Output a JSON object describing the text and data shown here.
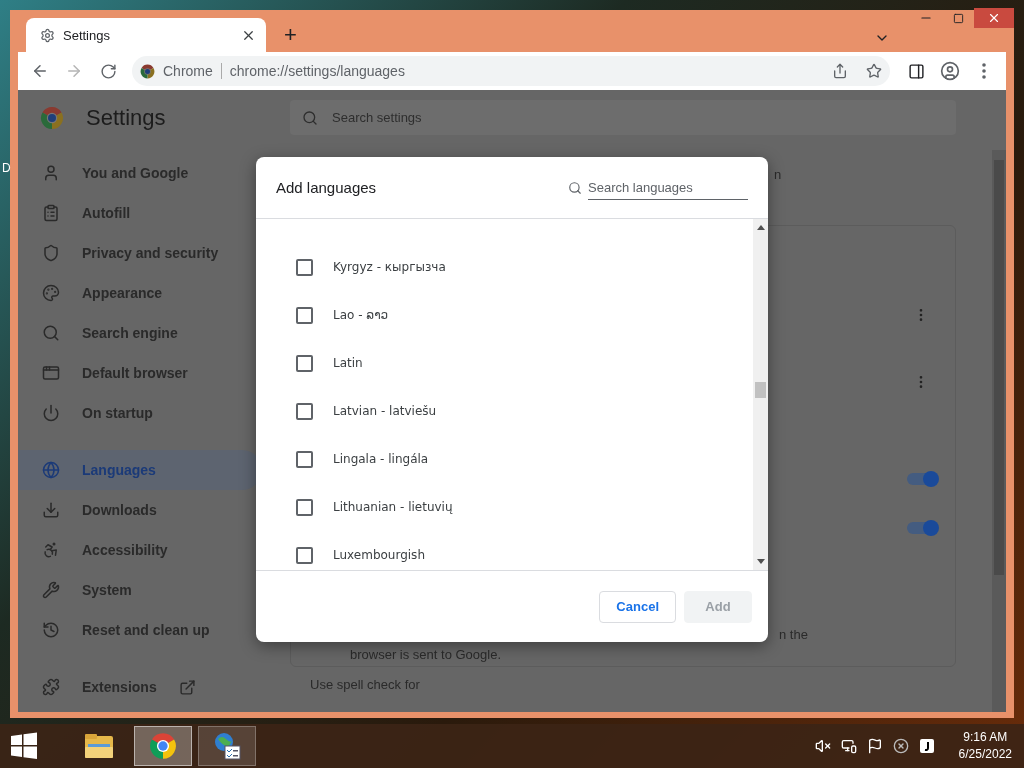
{
  "desktop": {
    "edge_text": "D"
  },
  "window": {
    "tabs": [
      {
        "title": "Settings",
        "selected": true
      }
    ],
    "new_tab": "+"
  },
  "toolbar": {
    "back_enabled": true,
    "forward_enabled": false,
    "chip": "Chrome",
    "url": "chrome://settings/languages"
  },
  "settings": {
    "title": "Settings",
    "search_placeholder": "Search settings",
    "sidebar": [
      {
        "label": "You and Google",
        "selected": false
      },
      {
        "label": "Autofill",
        "selected": false
      },
      {
        "label": "Privacy and security",
        "selected": false
      },
      {
        "label": "Appearance",
        "selected": false
      },
      {
        "label": "Search engine",
        "selected": false
      },
      {
        "label": "Default browser",
        "selected": false
      },
      {
        "label": "On startup",
        "selected": false
      },
      {
        "label": "Languages",
        "selected": true
      },
      {
        "label": "Downloads",
        "selected": false
      },
      {
        "label": "Accessibility",
        "selected": false
      },
      {
        "label": "System",
        "selected": false
      },
      {
        "label": "Reset and clean up",
        "selected": false
      }
    ],
    "extensions": "Extensions",
    "content": {
      "fragment_top": "n",
      "toggles": [
        {
          "on": true
        },
        {
          "on": true
        }
      ],
      "fragment_line": "n the",
      "line_2": "browser is sent to Google.",
      "section": "Use spell check for"
    }
  },
  "dialog": {
    "title": "Add languages",
    "search_placeholder": "Search languages",
    "languages": [
      {
        "label": "Kyrgyz - кыргызча",
        "checked": false
      },
      {
        "label": "Lao - ລາວ",
        "checked": false
      },
      {
        "label": "Latin",
        "checked": false
      },
      {
        "label": "Latvian - latviešu",
        "checked": false
      },
      {
        "label": "Lingala - lingála",
        "checked": false
      },
      {
        "label": "Lithuanian - lietuvių",
        "checked": false
      },
      {
        "label": "Luxembourgish",
        "checked": false
      }
    ],
    "buttons": [
      {
        "label": "Cancel",
        "disabled": false
      },
      {
        "label": "Add",
        "disabled": true
      }
    ]
  },
  "taskbar": {
    "apps": [
      {
        "kind": "explorer",
        "active": false,
        "running": false
      },
      {
        "kind": "chrome",
        "active": true,
        "running": true
      },
      {
        "kind": "network",
        "active": false,
        "running": true
      }
    ],
    "time": "9:16 AM",
    "date": "6/25/2022"
  }
}
